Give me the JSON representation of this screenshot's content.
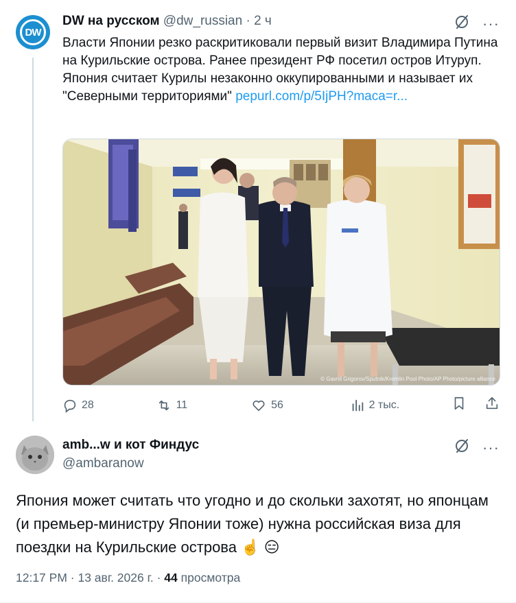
{
  "tweet": {
    "author_name": "DW на русском",
    "handle": "@dw_russian",
    "time": "· 2 ч",
    "avatar_text": "DW",
    "text": "Власти Японии резко раскритиковали первый визит Владимира Путина на Курильские острова. Ранее президент РФ посетил остров Итуруп. Япония считает Курилы незаконно оккупированными и называет их \"Северными территориями\"",
    "link": "pepurl.com/p/5IjPH?maca=r...",
    "photo_credit": "© Gavriil Grigorov/Sputnik/Kremlin Pool Photo/AP Photo/picture alliance",
    "metrics": {
      "replies": "28",
      "retweets": "11",
      "likes": "56",
      "views": "2 тыс."
    }
  },
  "reply": {
    "author_name": "amb...w и кот Финдус",
    "handle": "@ambaranow",
    "text": "Япония может считать что угодно и до скольки захотят, но японцам (и премьер-министру Японии тоже) нужна российская виза для поездки на Курильские острова",
    "emoji_1": "☝️",
    "emoji_2": "😑",
    "time": "12:17 PM",
    "date": "13 авг. 2026 г.",
    "sep1": "·",
    "sep2": "·",
    "views_count": "44",
    "views_label": "просмотра"
  },
  "colors": {
    "link": "#1d9bf0",
    "secondary": "#536471",
    "dw_blue": "#1c8fd1"
  }
}
